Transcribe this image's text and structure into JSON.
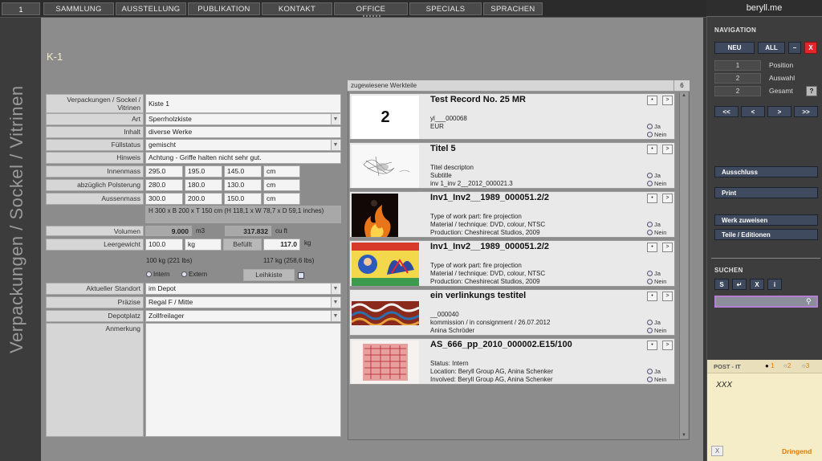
{
  "nav": {
    "page_number": "1",
    "items": [
      "SAMMLUNG",
      "AUSSTELLUNG",
      "PUBLIKATION",
      "KONTAKT",
      "OFFICE",
      "SPECIALS",
      "SPRACHEN"
    ]
  },
  "sidebar_title": "Verpackungen / Sockel / Vitrinen",
  "record": {
    "id": "K-1",
    "fields": {
      "verpackungen_label": "Verpackungen / Sockel / Vitrinen",
      "verpackungen_value": "Kiste 1",
      "art_label": "Art",
      "art_value": "Sperrholzkiste",
      "inhalt_label": "Inhalt",
      "inhalt_value": "diverse Werke",
      "fuellstatus_label": "Füllstatus",
      "fuellstatus_value": "gemischt",
      "hinweis_label": "Hinweis",
      "hinweis_value": "Achtung - Griffe halten nicht sehr gut.",
      "innenmass_label": "Innenmass",
      "innenmass": [
        "295.0",
        "195.0",
        "145.0",
        "cm"
      ],
      "polsterung_label": "abzüglich Polsterung",
      "polsterung": [
        "280.0",
        "180.0",
        "130.0",
        "cm"
      ],
      "aussenmass_label": "Aussenmass",
      "aussenmass": [
        "300.0",
        "200.0",
        "150.0",
        "cm"
      ],
      "dimension_text": "H 300 x B 200 x T 150 cm (H 118,1 x W 78,7 x D 59,1 inches)",
      "volumen_label": "Volumen",
      "volumen_m3": "9.000",
      "volumen_m3_unit": "m3",
      "volumen_cuft": "317.832",
      "volumen_cuft_unit": "cu ft",
      "leergewicht_label": "Leergewicht",
      "leergewicht_value": "100.0",
      "leergewicht_unit": "kg",
      "befuellt_label": "Befüllt",
      "befuellt_value": "117.0",
      "befuellt_unit": "kg",
      "leergewicht_lbs": "100 kg (221 lbs)",
      "befuellt_lbs": "117 kg (258,6 lbs)",
      "intern_label": "Intern",
      "extern_label": "Extern",
      "leihkiste_label": "Leihkiste",
      "standort_label": "Aktueller Standort",
      "standort_value": "im Depot",
      "praezise_label": "Präzise",
      "praezise_value": "Regal F / Mitte",
      "depotplatz_label": "Depotplatz",
      "depotplatz_value": "Zollfreilager",
      "anmerkung_label": "Anmerkung"
    }
  },
  "works": {
    "header": "zugewiesene Werkteile",
    "count": "6",
    "ja": "Ja",
    "nein": "Nein",
    "items": [
      {
        "title": "Test Record No. 25 MR",
        "lines": [
          "yl___000068",
          "EUR"
        ],
        "thumb": "2"
      },
      {
        "title": "Titel 5",
        "lines": [
          "Titel descripton",
          "Subtitle",
          "inv 1_inv 2__2012_000021.3"
        ],
        "thumb": ""
      },
      {
        "title": "Inv1_Inv2__1989_000051.2/2",
        "lines": [
          "Type of work part: fire projection",
          "Material / technique: DVD, colour, NTSC",
          "Production: Cheshirecat Studios, 2009"
        ],
        "thumb": ""
      },
      {
        "title": "Inv1_Inv2__1989_000051.2/2",
        "lines": [
          "Type of work part: fire projection",
          "Material / technique: DVD, colour, NTSC",
          "Production: Cheshirecat Studios, 2009"
        ],
        "thumb": ""
      },
      {
        "title": "ein verlinkungs testitel",
        "lines": [
          "__000040",
          "kommission / in consignment / 26.07.2012",
          "Anina Schröder"
        ],
        "thumb": ""
      },
      {
        "title": "AS_666_pp_2010_000002.E15/100",
        "lines": [
          "Status: Intern",
          "Location: Beryll Group AG, Anina Schenker",
          "Involved: Beryll Group AG, Anina Schenker"
        ],
        "thumb": ""
      }
    ]
  },
  "right": {
    "brand": "beryll.me",
    "navigation_label": "NAVIGATION",
    "neu": "NEU",
    "all": "ALL",
    "minus": "–",
    "close": "X",
    "position_value": "1",
    "position_label": "Position",
    "auswahl_value": "2",
    "auswahl_label": "Auswahl",
    "gesamt_value": "2",
    "gesamt_label": "Gesamt",
    "help": "?",
    "first": "<<",
    "prev": "<",
    "next": ">",
    "last": ">>",
    "ausschluss": "Ausschluss",
    "print": "Print",
    "werk_zuweisen": "Werk zuweisen",
    "teile": "Teile / Editionen",
    "suchen_label": "SUCHEN",
    "s_btn": "S",
    "enter_btn": "↵",
    "x_btn": "X",
    "i_btn": "i",
    "search_placeholder": "",
    "postit_label": "POST - IT",
    "postit_opts": [
      "1",
      "2",
      "3"
    ],
    "postit_text": "XXX",
    "postit_close": "X",
    "dringend": "Dringend"
  },
  "colors": {
    "accent_red": "#e0262b",
    "button_blue": "#3f4a5e",
    "postit": "#f5ecc8"
  }
}
